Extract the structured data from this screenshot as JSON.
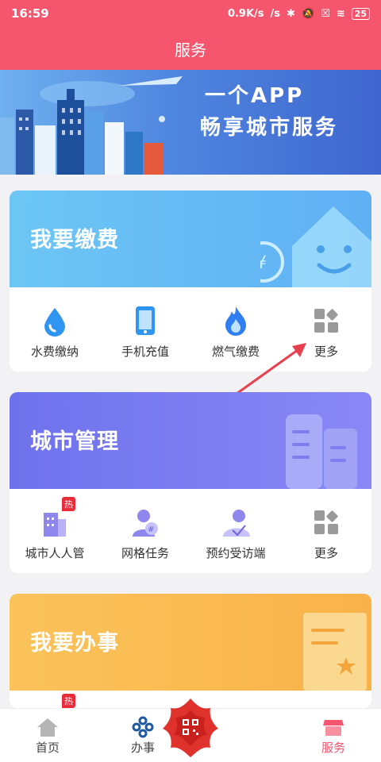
{
  "status_bar": {
    "time": "16:59",
    "speed": "0.9K/s",
    "battery": "25"
  },
  "header": {
    "title": "服务"
  },
  "banner": {
    "line1": "一个APP",
    "line2": "畅享城市服务"
  },
  "cards": [
    {
      "title": "我要缴费",
      "items": [
        {
          "label": "水费缴纳",
          "icon": "water-drop-icon"
        },
        {
          "label": "手机充值",
          "icon": "phone-icon"
        },
        {
          "label": "燃气缴费",
          "icon": "flame-icon"
        },
        {
          "label": "更多",
          "icon": "grid-more-icon"
        }
      ]
    },
    {
      "title": "城市管理",
      "items": [
        {
          "label": "城市人人管",
          "icon": "building-icon",
          "badge": "热"
        },
        {
          "label": "网格任务",
          "icon": "grid-user-icon"
        },
        {
          "label": "预约受访端",
          "icon": "visitor-icon"
        },
        {
          "label": "更多",
          "icon": "grid-more-icon"
        }
      ]
    },
    {
      "title": "我要办事",
      "items": [
        {
          "badge": "热"
        }
      ]
    }
  ],
  "tabbar": {
    "items": [
      {
        "label": "首页",
        "icon": "home-icon"
      },
      {
        "label": "办事",
        "icon": "knot-icon"
      },
      {
        "label": "",
        "icon": "qr-scan-icon"
      },
      {
        "label": "服务",
        "icon": "shop-icon"
      }
    ]
  },
  "colors": {
    "primary": "#f5566e",
    "arrow": "#e8404e"
  }
}
